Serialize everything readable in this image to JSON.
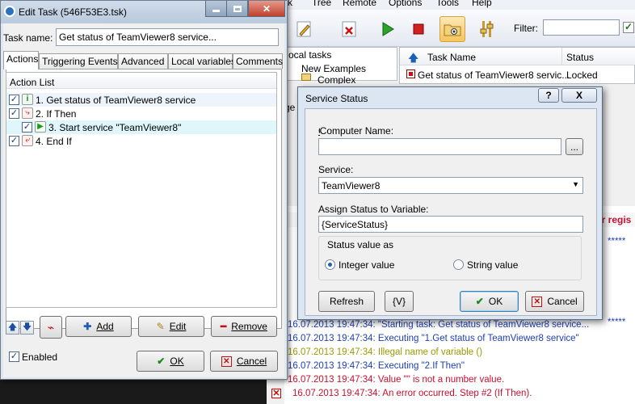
{
  "bg_app": {
    "menu": [
      "sk",
      "Tree",
      "Remote",
      "Options",
      "Tools",
      "Help"
    ],
    "filter_label": "Filter:",
    "tree_items": [
      "ocal tasks",
      "New Examples",
      "Complex"
    ],
    "tasklist": {
      "columns": [
        "Task Name",
        "Status"
      ],
      "rows": [
        {
          "name": "Get status of TeamViewer8 servic...",
          "status": "Locked"
        }
      ]
    },
    "side_fragment": "ge",
    "log_header_fragment": "er regis",
    "log_lines": [
      {
        "text": "*****",
        "color": "#1f3fb0"
      },
      {
        "text": "*****",
        "color": "#1f3fb0"
      },
      {
        "text": "16.07.2013 19:47:34: \"Starting task: Get status of TeamViewer8 service...",
        "color": "#1f3fb0"
      },
      {
        "text": "16.07.2013 19:47:34: Executing \"1.Get status of TeamViewer8 service\"",
        "color": "#1f3fb0"
      },
      {
        "text": "16.07.2013 19:47:34: Illegal name of variable ()",
        "color": "#9a9a00"
      },
      {
        "text": "16.07.2013 19:47:34: Executing \"2.If Then\"",
        "color": "#1f3fb0"
      },
      {
        "text": "16.07.2013 19:47:34: Value \"\" is not a number value.",
        "color": "#c8102e"
      },
      {
        "text": "16.07.2013 19:47:34: An error occurred. Step #2 (If Then).",
        "color": "#c8102e"
      }
    ]
  },
  "edit_task": {
    "title": "Edit Task (546F53E3.tsk)",
    "task_name_label": "Task name:",
    "task_name_value": "Get status of TeamViewer8 service...",
    "tabs": [
      "Actions",
      "Triggering Events",
      "Advanced",
      "Local variables",
      "Comments"
    ],
    "action_list_label": "Action List",
    "actions": [
      {
        "text": "1. Get status of TeamViewer8 service",
        "icon": "info-icon"
      },
      {
        "text": "2. If Then",
        "icon": "branch-icon"
      },
      {
        "text": "3. Start service \"TeamViewer8\"",
        "icon": "play-icon"
      },
      {
        "text": "4. End If",
        "icon": "end-branch-icon"
      }
    ],
    "buttons": {
      "add": "Add",
      "edit": "Edit",
      "remove": "Remove",
      "ok": "OK",
      "cancel": "Cancel"
    },
    "enabled_label": "Enabled"
  },
  "service_status": {
    "title": "Service Status",
    "help_button": "?",
    "close_button": "X",
    "computer_name_label": "Computer Name:",
    "computer_name_value": "",
    "browse_button": "...",
    "service_label": "Service:",
    "service_value": "TeamViewer8",
    "assign_label": "Assign Status to Variable:",
    "assign_value": "{ServiceStatus}",
    "group_label": "Status value as",
    "radio_integer": "Integer value",
    "radio_string": "String value",
    "selected_radio": "Integer value",
    "refresh_button": "Refresh",
    "var_button": "{V}",
    "ok_button": "OK",
    "cancel_button": "Cancel"
  },
  "colors": {
    "accent": "#1c5fb8",
    "error": "#c8102e",
    "log_blue": "#1f3fb0"
  }
}
